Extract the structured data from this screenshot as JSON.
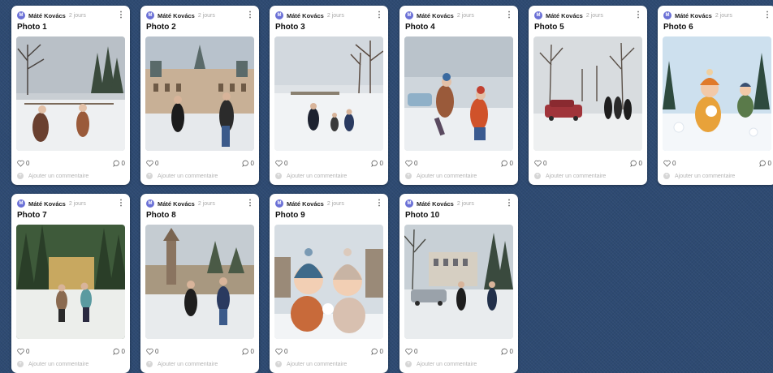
{
  "board": {
    "cards": [
      {
        "author": "Máté Kovács",
        "avatar": "M",
        "time": "2 jours",
        "title": "Photo 1",
        "likes": "0",
        "comments": "0",
        "add_comment": "Ajouter un commentaire",
        "scene": "snow-field-adults-trees"
      },
      {
        "author": "Máté Kovács",
        "avatar": "M",
        "time": "2 jours",
        "title": "Photo 2",
        "likes": "0",
        "comments": "0",
        "add_comment": "Ajouter un commentaire",
        "scene": "palace-couple-snowball"
      },
      {
        "author": "Máté Kovács",
        "avatar": "M",
        "time": "2 jours",
        "title": "Photo 3",
        "likes": "0",
        "comments": "0",
        "add_comment": "Ajouter un commentaire",
        "scene": "snowy-park-family"
      },
      {
        "author": "Máté Kovács",
        "avatar": "M",
        "time": "2 jours",
        "title": "Photo 4",
        "likes": "0",
        "comments": "0",
        "add_comment": "Ajouter un commentaire",
        "scene": "children-snowball-fight"
      },
      {
        "author": "Máté Kovács",
        "avatar": "M",
        "time": "2 jours",
        "title": "Photo 5",
        "likes": "0",
        "comments": "0",
        "add_comment": "Ajouter un commentaire",
        "scene": "snowy-road-red-car"
      },
      {
        "author": "Máté Kovács",
        "avatar": "M",
        "time": "2 jours",
        "title": "Photo 6",
        "likes": "0",
        "comments": "0",
        "add_comment": "Ajouter un commentaire",
        "scene": "cartoon-kids-snow"
      },
      {
        "author": "Máté Kovács",
        "avatar": "M",
        "time": "2 jours",
        "title": "Photo 7",
        "likes": "0",
        "comments": "0",
        "add_comment": "Ajouter un commentaire",
        "scene": "forest-clearing-couple"
      },
      {
        "author": "Máté Kovács",
        "avatar": "M",
        "time": "2 jours",
        "title": "Photo 8",
        "likes": "0",
        "comments": "0",
        "add_comment": "Ajouter un commentaire",
        "scene": "monument-courtyard-couple"
      },
      {
        "author": "Máté Kovács",
        "avatar": "M",
        "time": "2 jours",
        "title": "Photo 9",
        "likes": "0",
        "comments": "0",
        "add_comment": "Ajouter un commentaire",
        "scene": "cartoon-toddlers-hats"
      },
      {
        "author": "Máté Kovács",
        "avatar": "M",
        "time": "2 jours",
        "title": "Photo 10",
        "likes": "0",
        "comments": "0",
        "add_comment": "Ajouter un commentaire",
        "scene": "manor-car-couple"
      }
    ]
  },
  "icons": {
    "like": "heart-icon",
    "comment": "comment-icon",
    "menu": "more-vertical-icon",
    "add": "add-comment-icon"
  },
  "colors": {
    "board_background": "#2e4a72",
    "avatar": "#6a70d6",
    "card": "#ffffff"
  }
}
